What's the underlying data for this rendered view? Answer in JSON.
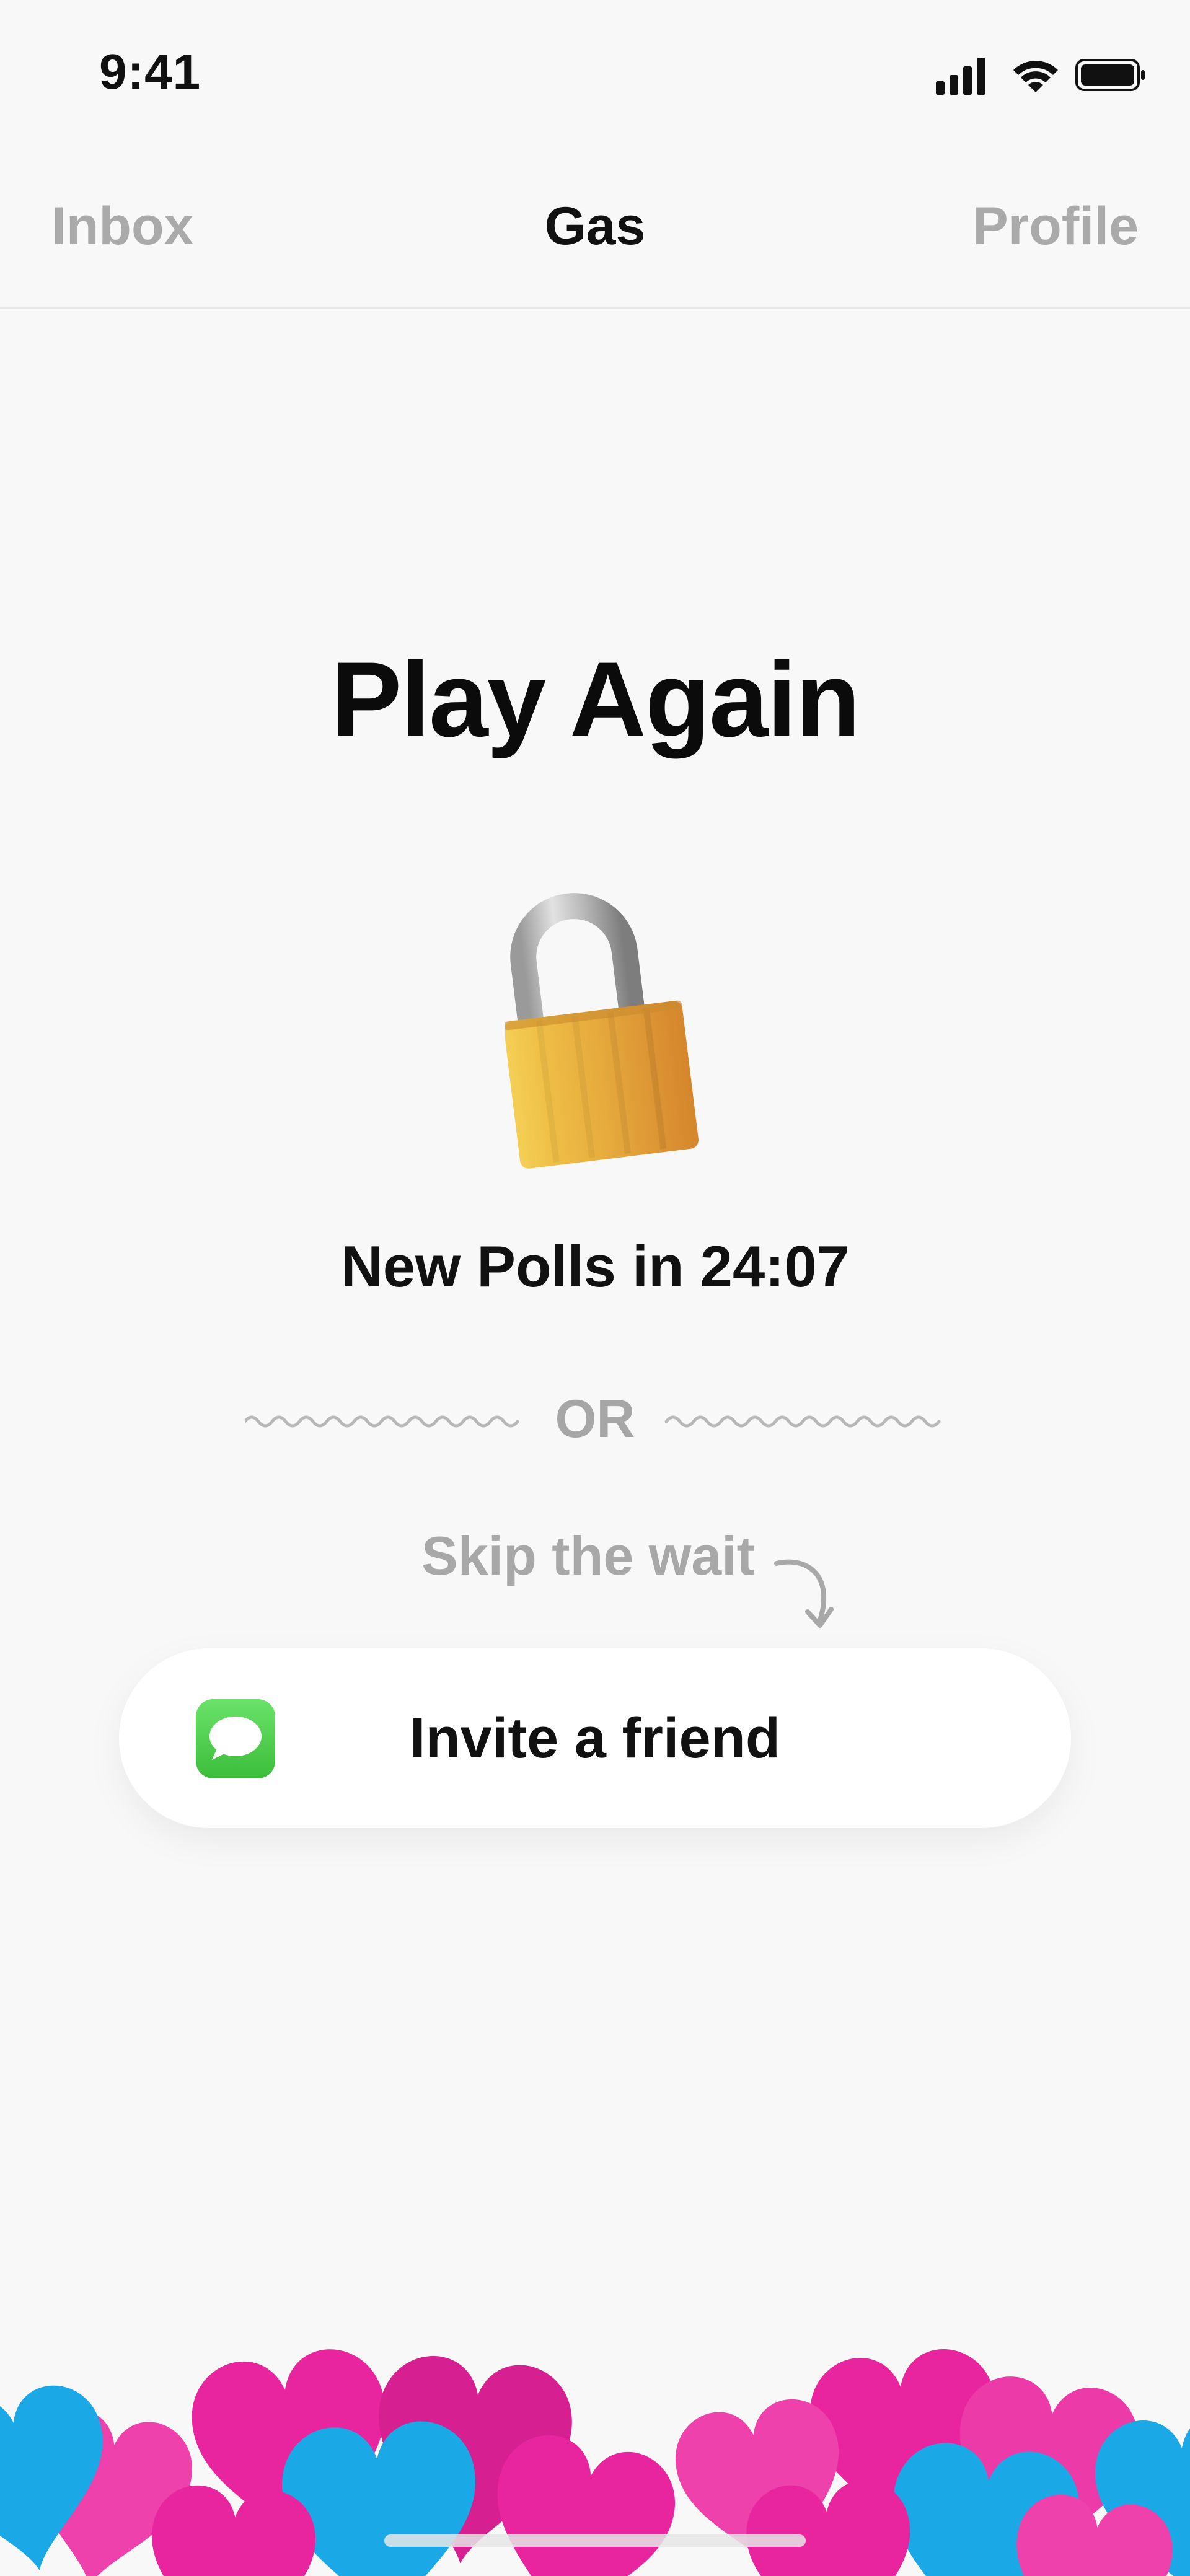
{
  "status_bar": {
    "time": "9:41",
    "icons": [
      "signal-icon",
      "wifi-icon",
      "battery-icon"
    ]
  },
  "nav": {
    "tabs": [
      {
        "label": "Inbox",
        "active": false
      },
      {
        "label": "Gas",
        "active": true
      },
      {
        "label": "Profile",
        "active": false
      }
    ]
  },
  "main": {
    "title": "Play Again",
    "lock_icon": "lock-icon",
    "countdown": "New Polls in 24:07",
    "or_text": "OR",
    "skip_text": "Skip the wait",
    "invite_button": {
      "label": "Invite a friend",
      "icon": "messages-icon"
    }
  },
  "colors": {
    "background": "#f8f8f8",
    "inactive_tab": "#aaaaaa",
    "heart_pink": "#e8259e",
    "heart_blue": "#1aa9e6",
    "messages_green": "#4cd04b"
  }
}
